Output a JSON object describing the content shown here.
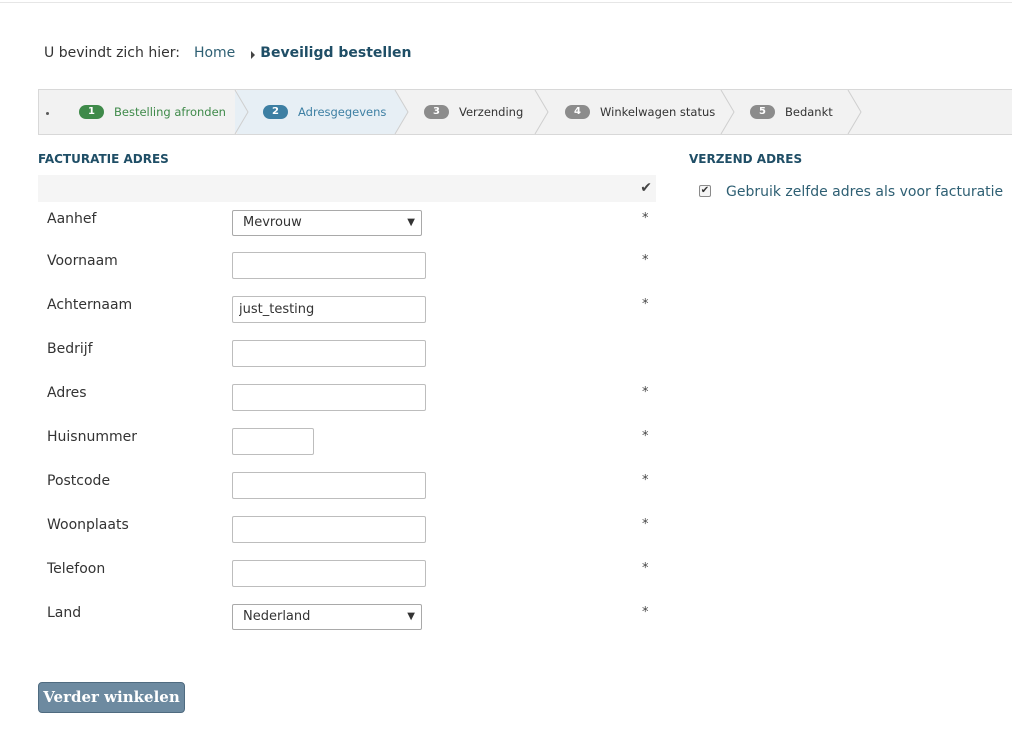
{
  "breadcrumb": {
    "prefix": "U bevindt zich hier:",
    "home": "Home",
    "current": "Beveiligd bestellen"
  },
  "steps": [
    {
      "num": "1",
      "label": "Bestelling afronden",
      "badge_color": "#3f8a4a",
      "text_color": "#3f8a4a"
    },
    {
      "num": "2",
      "label": "Adresgegevens",
      "badge_color": "#3d7fa3",
      "text_color": "#3d7fa3"
    },
    {
      "num": "3",
      "label": "Verzending",
      "badge_color": "#8c8c8c",
      "text_color": "#333333"
    },
    {
      "num": "4",
      "label": "Winkelwagen status",
      "badge_color": "#8c8c8c",
      "text_color": "#333333"
    },
    {
      "num": "5",
      "label": "Bedankt",
      "badge_color": "#8c8c8c",
      "text_color": "#333333"
    }
  ],
  "billing": {
    "title": "FACTURATIE ADRES",
    "header_icon": "checkmark-icon",
    "fields": {
      "aanhef": {
        "label": "Aanhef",
        "value": "Mevrouw",
        "required": "*"
      },
      "voornaam": {
        "label": "Voornaam",
        "value": "",
        "required": "*"
      },
      "achternaam": {
        "label": "Achternaam",
        "value": "just_testing",
        "required": "*"
      },
      "bedrijf": {
        "label": "Bedrijf",
        "value": "",
        "required": ""
      },
      "adres": {
        "label": "Adres",
        "value": "",
        "required": "*"
      },
      "huisnummer": {
        "label": "Huisnummer",
        "value": "",
        "required": "*"
      },
      "postcode": {
        "label": "Postcode",
        "value": "",
        "required": "*"
      },
      "woonplaats": {
        "label": "Woonplaats",
        "value": "",
        "required": "*"
      },
      "telefoon": {
        "label": "Telefoon",
        "value": "",
        "required": "*"
      },
      "land": {
        "label": "Land",
        "value": "Nederland",
        "required": "*"
      }
    }
  },
  "shipping": {
    "title": "VERZEND ADRES",
    "same_as_billing_label": "Gebruik zelfde adres als voor facturatie",
    "same_as_billing_checked": true
  },
  "actions": {
    "continue_label": "Verder winkelen"
  },
  "colors": {
    "accent": "#1f4e66",
    "link": "#2e5f73",
    "button": "#6d8aa0"
  }
}
